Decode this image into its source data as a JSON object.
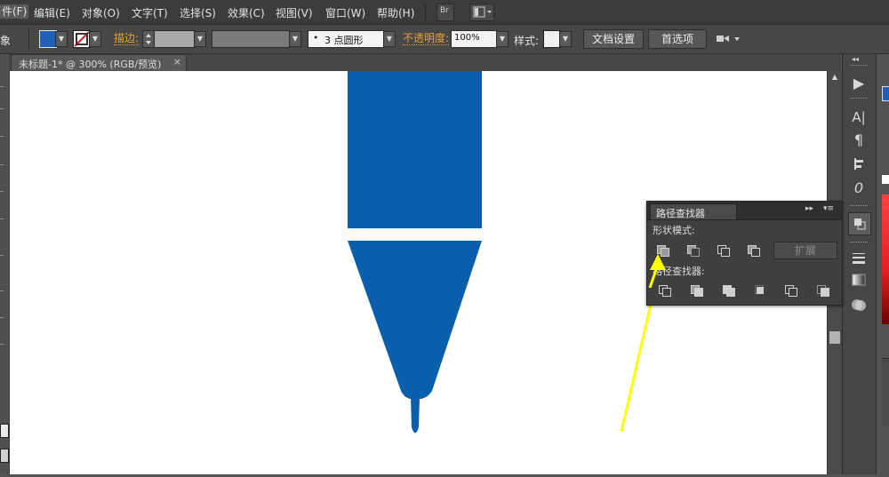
{
  "menubar": {
    "items": [
      "件(F)",
      "编辑(E)",
      "对象(O)",
      "文字(T)",
      "选择(S)",
      "效果(C)",
      "视图(V)",
      "窗口(W)",
      "帮助(H)"
    ],
    "bridge_label": "Br"
  },
  "controlbar": {
    "obj_label": "象",
    "fill_color": "#1f5fb8",
    "stroke_label": "描边:",
    "brush_label": "3 点圆形",
    "brush_dot": "•",
    "opacity_label": "不透明度:",
    "opacity_value": "100%",
    "style_label": "样式:",
    "doc_setup": "文档设置",
    "preferences": "首选项"
  },
  "document": {
    "tab_title": "未标题-1* @ 300% (RGB/预览)",
    "close_glyph": "×"
  },
  "artwork": {
    "fill": "#0a5fad",
    "shapes": [
      "rectangle",
      "triangle",
      "tip"
    ]
  },
  "pathfinder": {
    "title": "路径查找器",
    "collapse_glyph": "▸▸",
    "menu_glyph": "▾≡",
    "shape_modes_label": "形状模式:",
    "pathfinders_label": "路径查找器:",
    "expand_label": "扩展",
    "shape_modes": [
      "unite",
      "minus-front",
      "intersect",
      "exclude"
    ],
    "pathfinder_ops": [
      "divide",
      "trim",
      "merge",
      "crop",
      "outline",
      "minus-back"
    ]
  },
  "annotation": {
    "arrow_color": "#ffff00"
  },
  "dock": {
    "icons": [
      "play",
      "character",
      "paragraph",
      "align",
      "glyphs",
      "pathfinder",
      "stroke",
      "gradient",
      "transparency"
    ]
  }
}
